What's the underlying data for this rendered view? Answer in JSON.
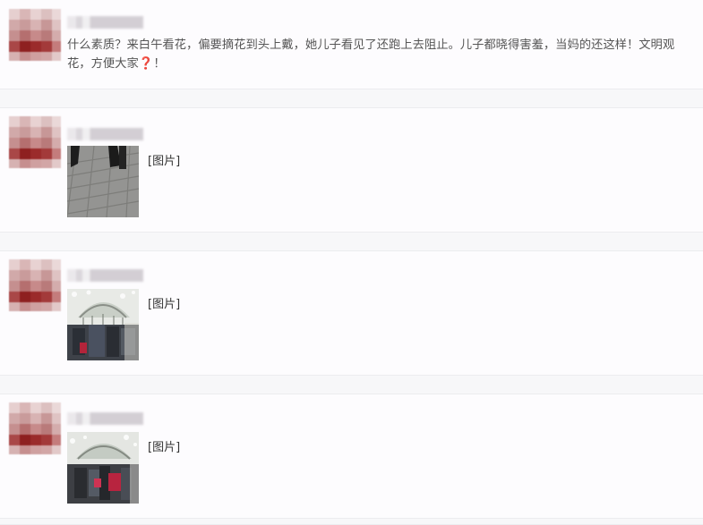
{
  "comments": [
    {
      "text": "什么素质？来白午看花，偏要摘花到头上戴，她儿子看见了还跑上去阻止。儿子都晓得害羞，当妈的还这样！文明观花，方便大家",
      "trail": "！"
    },
    {
      "image_label": "[图片]"
    },
    {
      "image_label": "[图片]"
    },
    {
      "image_label": "[图片]"
    }
  ],
  "icons": {
    "question": "❓"
  },
  "colors": {
    "background": "#fdfcfe",
    "separator": "#f7f7f9",
    "question_icon": "#c0302c"
  }
}
